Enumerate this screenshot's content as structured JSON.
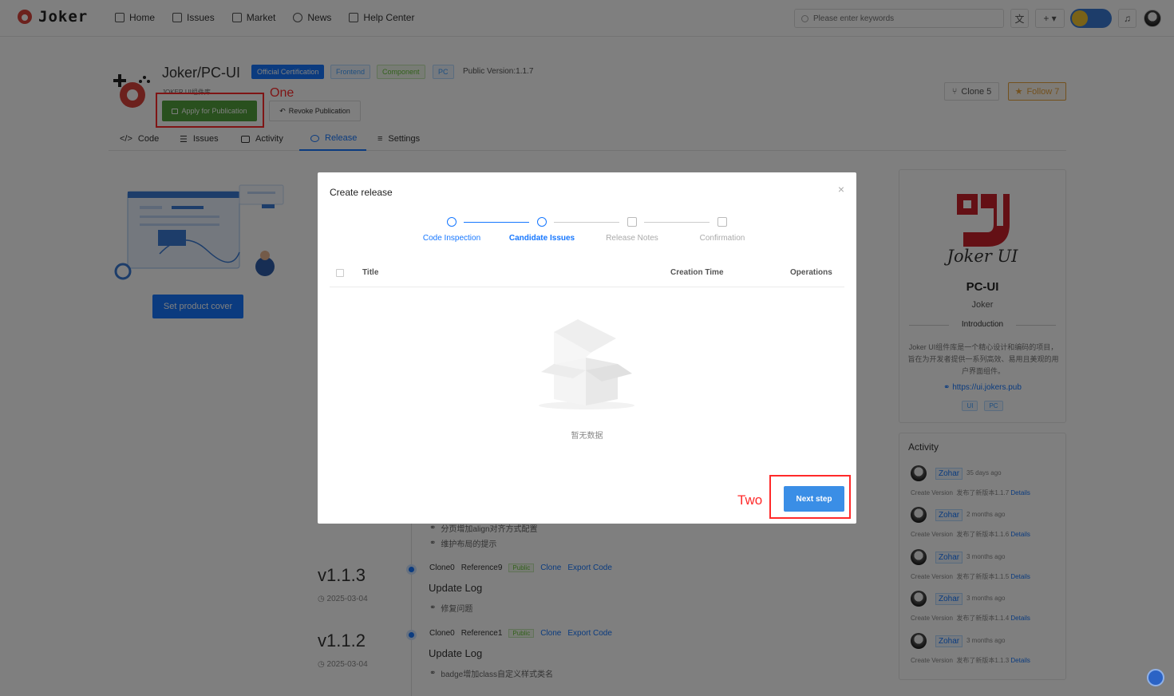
{
  "app": {
    "logo_text": "Joker"
  },
  "nav": {
    "items": [
      {
        "label": "Home",
        "icon": "home-icon"
      },
      {
        "label": "Issues",
        "icon": "list-icon"
      },
      {
        "label": "Market",
        "icon": "gift-icon"
      },
      {
        "label": "News",
        "icon": "user-icon"
      },
      {
        "label": "Help Center",
        "icon": "book-icon"
      }
    ],
    "search_placeholder": "Please enter keywords",
    "add_label": "+ ▾"
  },
  "repo": {
    "owner": "Joker",
    "name": "PC-UI",
    "tags": [
      "Official Certification",
      "Frontend",
      "Component",
      "PC"
    ],
    "public_version": "Public Version:1.1.7",
    "subtitle": "JOKER UI组件库",
    "apply_label": "Apply for Publication",
    "revoke_label": "Revoke Publication",
    "clone_label": "Clone 5",
    "follow_label": "Follow 7"
  },
  "annotations": {
    "one": "One",
    "two": "Two"
  },
  "tabs": [
    {
      "label": "Code"
    },
    {
      "label": "Issues"
    },
    {
      "label": "Activity"
    },
    {
      "label": "Release",
      "active": true
    },
    {
      "label": "Settings"
    }
  ],
  "cover": {
    "button_label": "Set product cover"
  },
  "card": {
    "logo_text": "Joker UI",
    "name": "PC-UI",
    "owner": "Joker",
    "intro_label": "Introduction",
    "description": "Joker UI组件库是一个精心设计和编码的项目，旨在为开发者提供一系列高效、易用且美观的用户界面组件。",
    "link": "https://ui.jokers.pub",
    "tags": [
      "UI",
      "PC"
    ]
  },
  "activity": {
    "title": "Activity",
    "create_label": "Create Version",
    "details_label": "Details",
    "items": [
      {
        "user": "Zohar",
        "time": "35 days ago",
        "desc": "发布了新版本1.1.7"
      },
      {
        "user": "Zohar",
        "time": "2 months ago",
        "desc": "发布了新版本1.1.6"
      },
      {
        "user": "Zohar",
        "time": "3 months ago",
        "desc": "发布了新版本1.1.5"
      },
      {
        "user": "Zohar",
        "time": "3 months ago",
        "desc": "发布了新版本1.1.4"
      },
      {
        "user": "Zohar",
        "time": "3 months ago",
        "desc": "发布了新版本1.1.3"
      }
    ]
  },
  "timeline": {
    "partial_notes": [
      "分页增加align对齐方式配置",
      "维护布局的提示"
    ],
    "releases": [
      {
        "version": "v1.1.3",
        "date": "2025-03-04",
        "clone": "Clone0",
        "reference": "Reference9",
        "badge": "Public",
        "clone_action": "Clone",
        "export_action": "Export Code",
        "log_title": "Update Log",
        "notes": [
          "修复问题"
        ]
      },
      {
        "version": "v1.1.2",
        "date": "2025-03-04",
        "clone": "Clone0",
        "reference": "Reference1",
        "badge": "Public",
        "clone_action": "Clone",
        "export_action": "Export Code",
        "log_title": "Update Log",
        "notes": [
          "badge增加class自定义样式类名"
        ]
      }
    ]
  },
  "modal": {
    "title": "Create release",
    "close": "×",
    "steps": [
      {
        "label": "Code Inspection",
        "state": "done"
      },
      {
        "label": "Candidate Issues",
        "state": "active"
      },
      {
        "label": "Release Notes",
        "state": "pending"
      },
      {
        "label": "Confirmation",
        "state": "pending"
      }
    ],
    "columns": {
      "title": "Title",
      "created": "Creation Time",
      "ops": "Operations"
    },
    "empty_text": "暂无数据",
    "next_label": "Next step"
  },
  "colors": {
    "primary": "#1677ff",
    "success": "#52a13c",
    "annotation": "#ff2a2a"
  }
}
